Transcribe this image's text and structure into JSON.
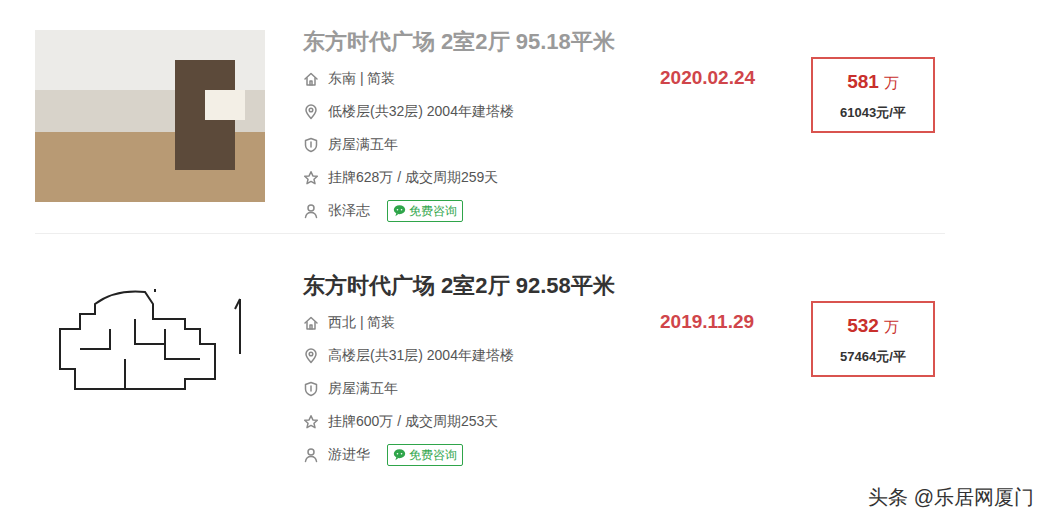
{
  "listings": [
    {
      "title": "东方时代广场 2室2厅 95.18平米",
      "visited": true,
      "image_kind": "photo",
      "orientation": "东南 | 简装",
      "floor": "低楼层(共32层) 2004年建塔楼",
      "tag": "房屋满五年",
      "listing": "挂牌628万 / 成交周期259天",
      "agent": "张泽志",
      "consult": "免费咨询",
      "date": "2020.02.24",
      "price": "581",
      "price_unit": "万",
      "unit_price": "61043元/平"
    },
    {
      "title": "东方时代广场 2室2厅 92.58平米",
      "visited": false,
      "image_kind": "floorplan",
      "orientation": "西北 | 简装",
      "floor": "高楼层(共31层) 2004年建塔楼",
      "tag": "房屋满五年",
      "listing": "挂牌600万 / 成交周期253天",
      "agent": "游进华",
      "consult": "免费咨询",
      "date": "2019.11.29",
      "price": "532",
      "price_unit": "万",
      "unit_price": "57464元/平"
    }
  ],
  "watermark": "头条 @乐居网厦门"
}
